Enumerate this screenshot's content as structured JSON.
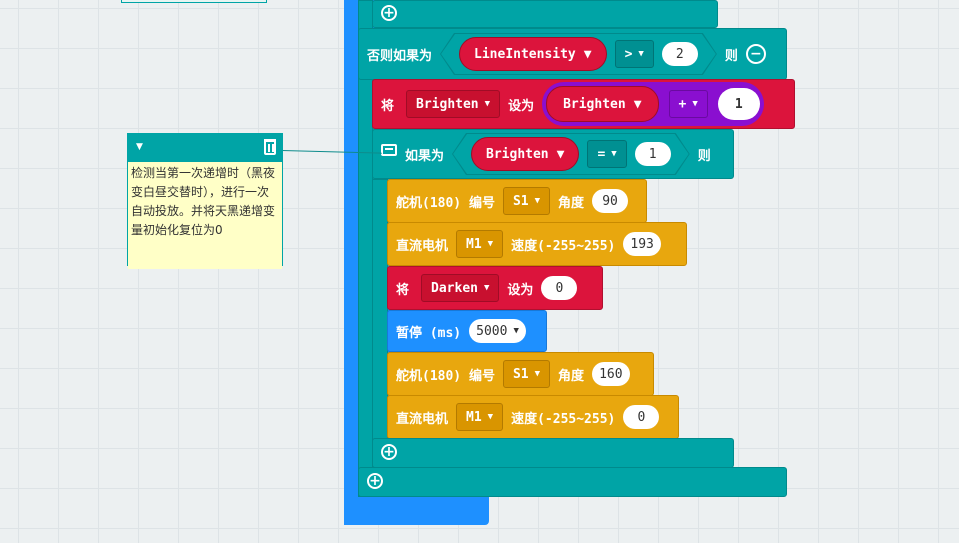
{
  "colors": {
    "canvas": "#ecf0f1",
    "logic": "#00a4a6",
    "variable": "#dc143c",
    "servo": "#e8a70e",
    "basic": "#1e90ff",
    "math": "#8a0fd0",
    "comment": "#ffffc7"
  },
  "elseif": {
    "label": "否则如果为",
    "var": "LineIntensity",
    "op": ">",
    "value": "2",
    "then": "则"
  },
  "set1": {
    "label_set": "将",
    "var": "Brighten",
    "label_to": "设为",
    "expr_var": "Brighten",
    "op": "+",
    "value": "1"
  },
  "inner_if": {
    "label": "如果为",
    "var": "Brighten",
    "op": "=",
    "value": "1",
    "then": "则"
  },
  "servo1": {
    "label": "舵机(180) 编号",
    "port": "S1",
    "angle_label": "角度",
    "angle": "90"
  },
  "motor1": {
    "label": "直流电机",
    "port": "M1",
    "speed_label": "速度(-255~255)",
    "speed": "193"
  },
  "set2": {
    "label_set": "将",
    "var": "Darken",
    "label_to": "设为",
    "value": "0"
  },
  "pause": {
    "label": "暂停 (ms)",
    "value": "5000"
  },
  "servo2": {
    "label": "舵机(180) 编号",
    "port": "S1",
    "angle_label": "角度",
    "angle": "160"
  },
  "motor2": {
    "label": "直流电机",
    "port": "M1",
    "speed_label": "速度(-255~255)",
    "speed": "0"
  },
  "comment": {
    "text": "检测当第一次递增时（黑夜变白昼交替时），进行一次自动投放。并将天黑递增变量初始化复位为0"
  },
  "icons": {
    "add": "plus-circle-icon",
    "remove": "minus-circle-icon",
    "delete": "trash-icon",
    "collapse": "caret-down-icon",
    "comment": "comment-icon"
  }
}
